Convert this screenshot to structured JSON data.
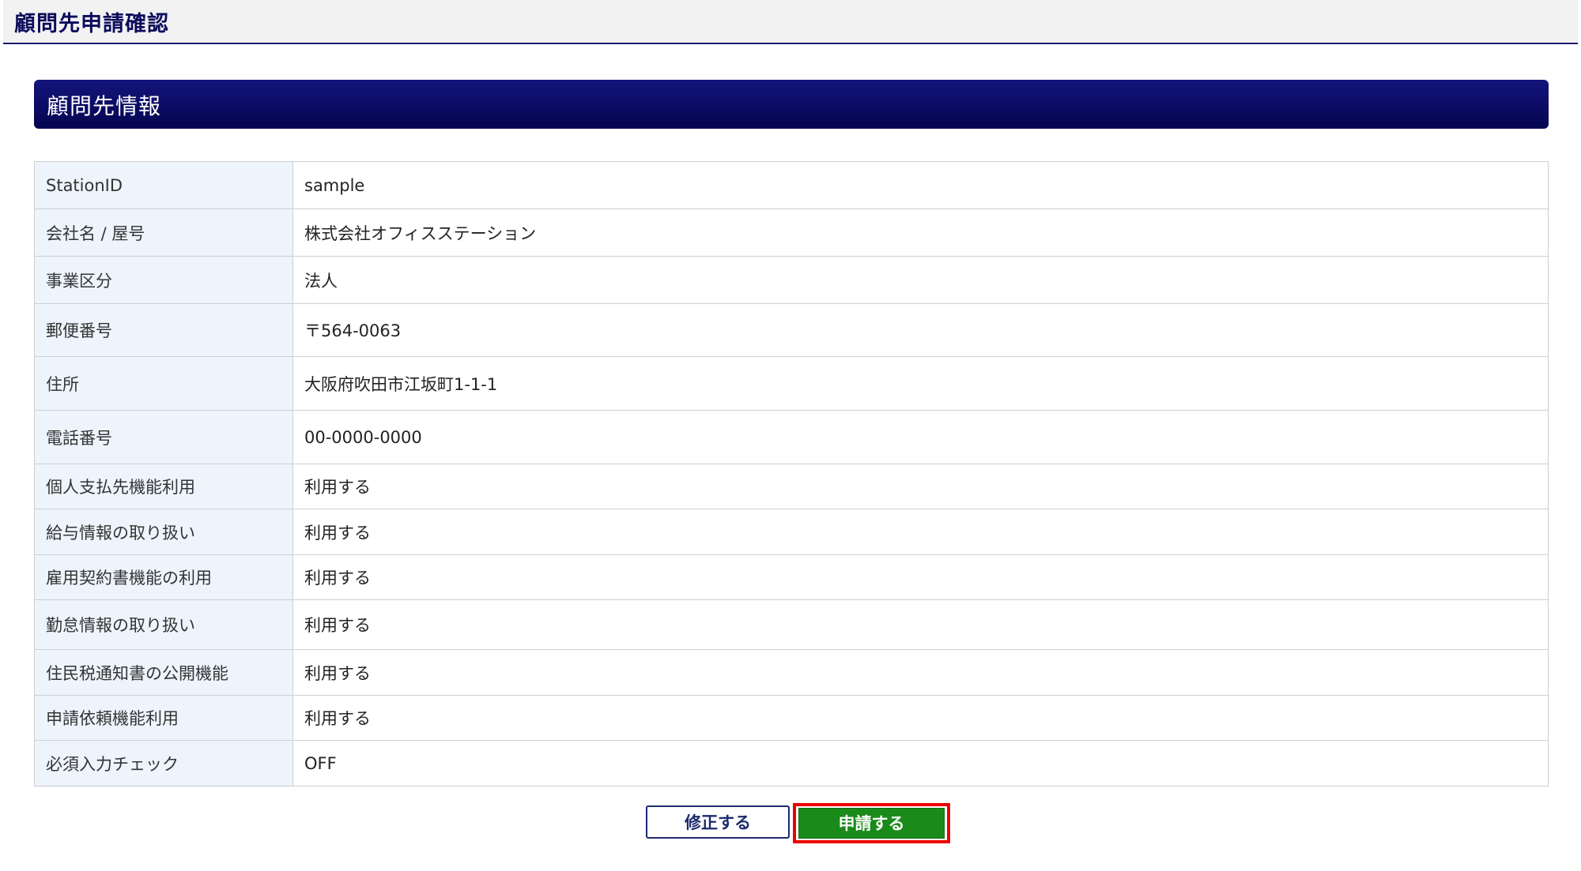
{
  "header": {
    "title": "顧問先申請確認"
  },
  "section": {
    "title": "顧問先情報"
  },
  "rows": [
    {
      "label": "StationID",
      "value": "sample"
    },
    {
      "label": "会社名 / 屋号",
      "value": "株式会社オフィスステーション"
    },
    {
      "label": "事業区分",
      "value": "法人"
    },
    {
      "label": "郵便番号",
      "value": "〒564-0063"
    },
    {
      "label": "住所",
      "value": "大阪府吹田市江坂町1-1-1"
    },
    {
      "label": "電話番号",
      "value": "00-0000-0000"
    },
    {
      "label": "個人支払先機能利用",
      "value": "利用する"
    },
    {
      "label": "給与情報の取り扱い",
      "value": "利用する"
    },
    {
      "label": "雇用契約書機能の利用",
      "value": "利用する"
    },
    {
      "label": "勤怠情報の取り扱い",
      "value": "利用する"
    },
    {
      "label": "住民税通知書の公開機能",
      "value": "利用する"
    },
    {
      "label": "申請依頼機能利用",
      "value": "利用する"
    },
    {
      "label": "必須入力チェック",
      "value": "OFF"
    }
  ],
  "buttons": {
    "edit_label": "修正する",
    "apply_label": "申請する"
  },
  "colors": {
    "header_accent": "#0d0d5c",
    "section_bar": "#0a0a66",
    "label_cell_bg": "#edf4fb",
    "apply_button": "#1a8a1a",
    "highlight_outline": "#ee0000"
  }
}
